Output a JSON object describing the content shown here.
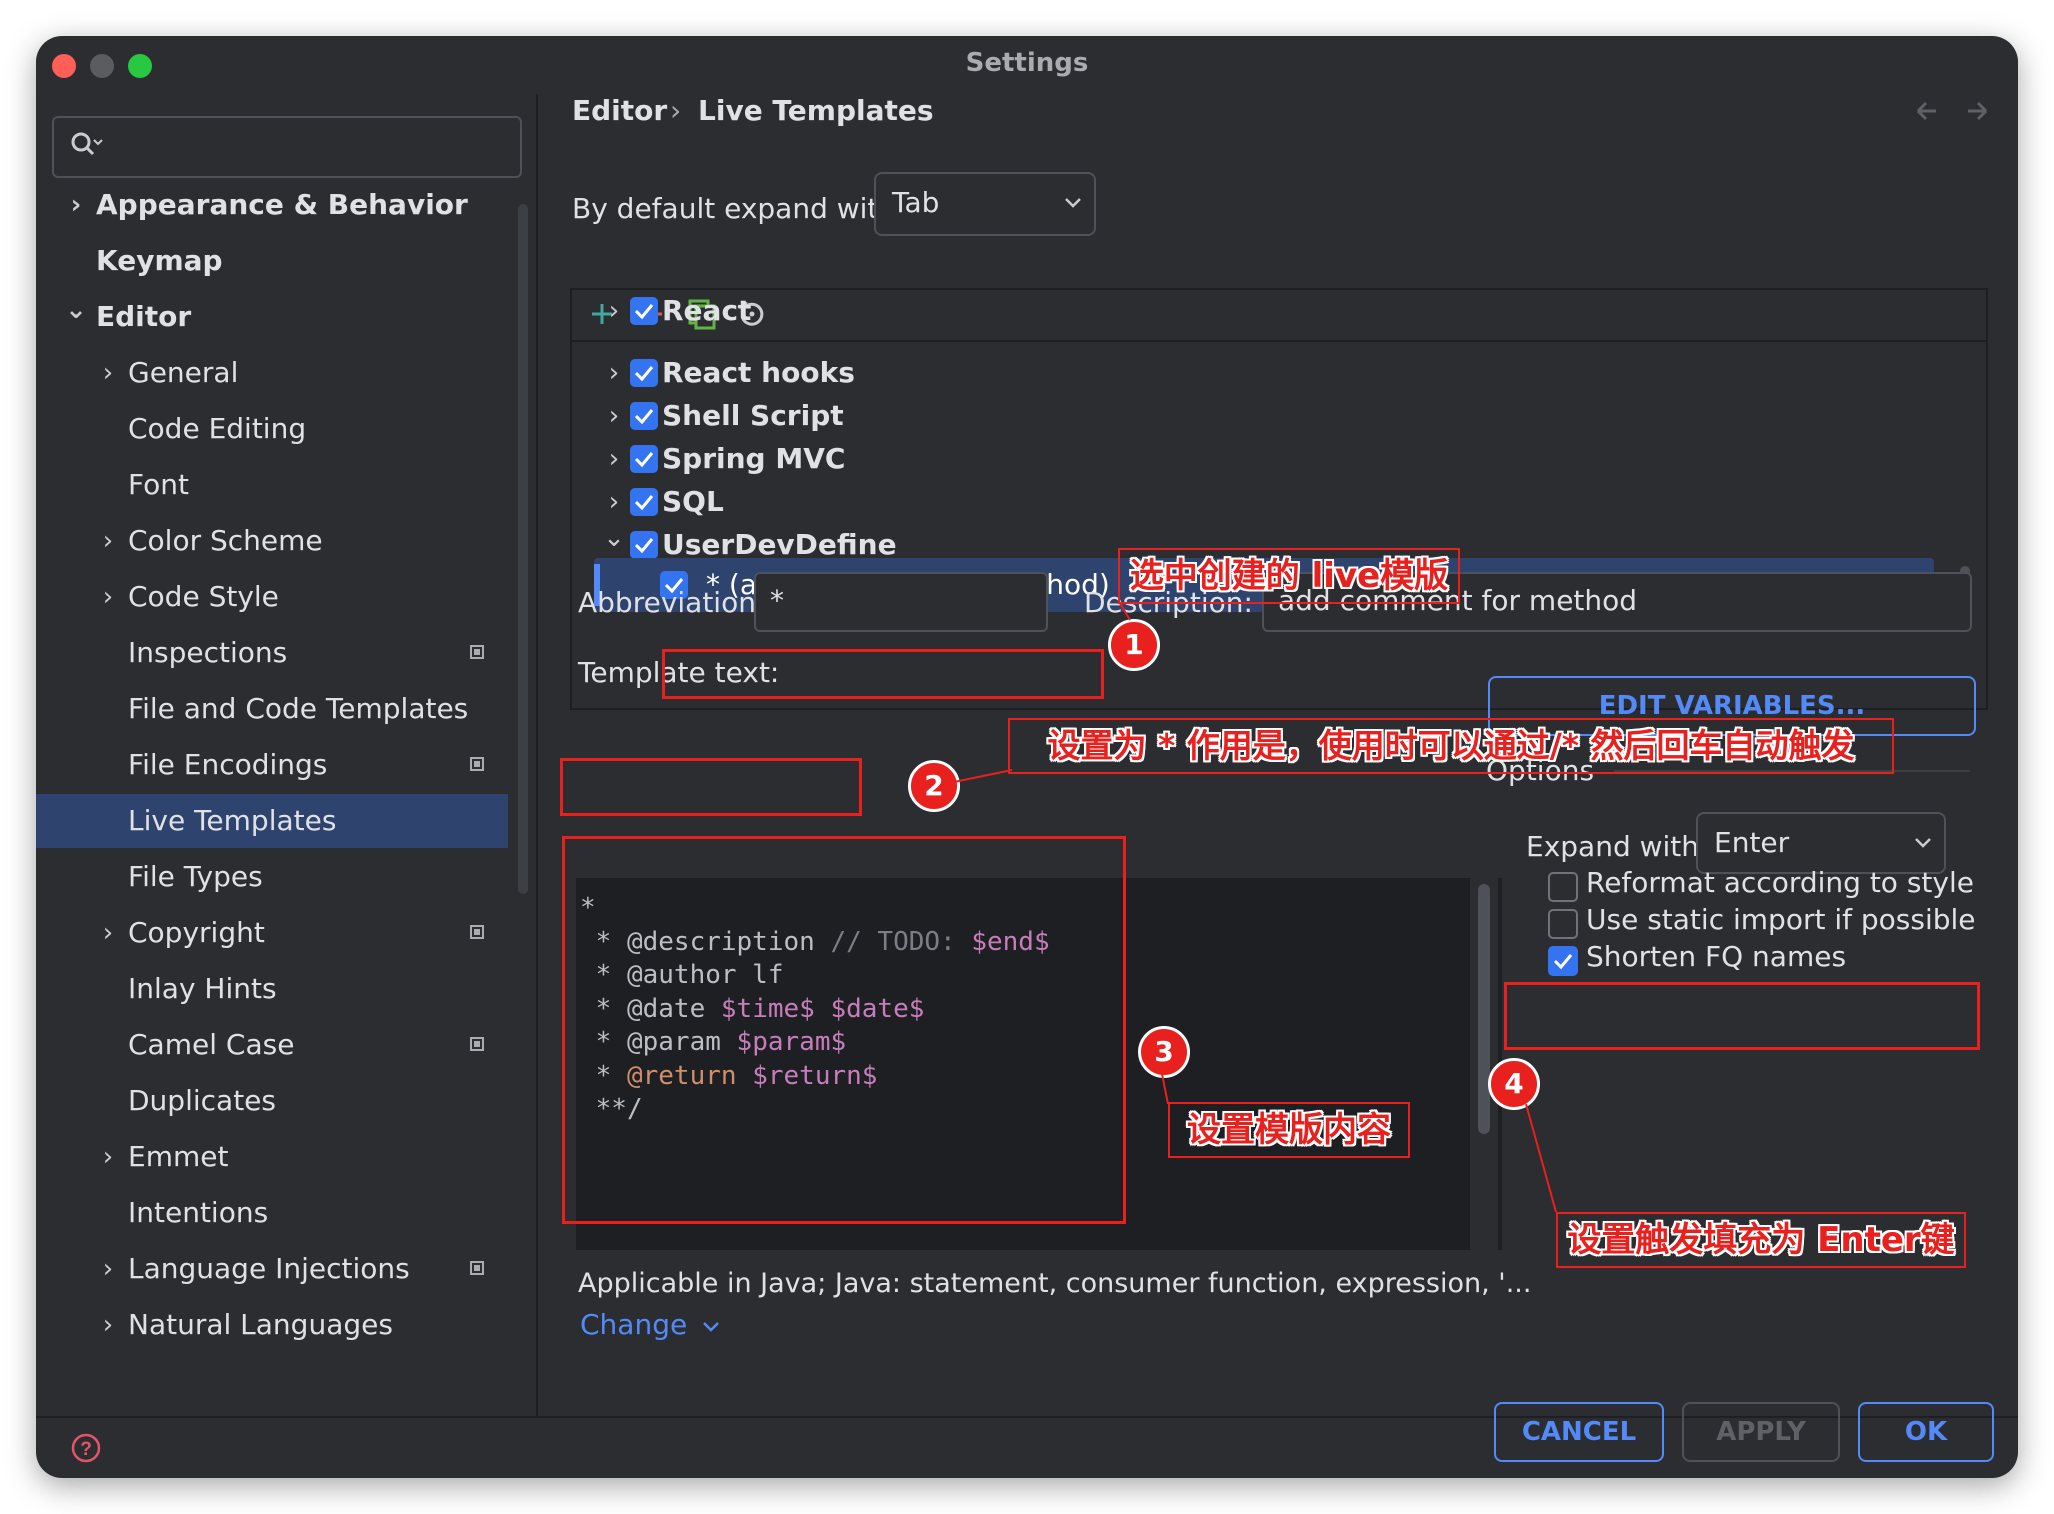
{
  "window": {
    "title": "Settings"
  },
  "sidebar": {
    "search_placeholder": "",
    "items": [
      {
        "label": "Appearance & Behavior",
        "chevron": "right",
        "bold": true
      },
      {
        "label": "Keymap",
        "bold": true
      },
      {
        "label": "Editor",
        "chevron": "down",
        "bold": true
      },
      {
        "label": "General",
        "chevron": "right"
      },
      {
        "label": "Code Editing"
      },
      {
        "label": "Font"
      },
      {
        "label": "Color Scheme",
        "chevron": "right"
      },
      {
        "label": "Code Style",
        "chevron": "right"
      },
      {
        "label": "Inspections",
        "badge_icon": "project-level-icon"
      },
      {
        "label": "File and Code Templates"
      },
      {
        "label": "File Encodings",
        "badge_icon": "project-level-icon"
      },
      {
        "label": "Live Templates",
        "selected": true
      },
      {
        "label": "File Types"
      },
      {
        "label": "Copyright",
        "chevron": "right",
        "badge_icon": "project-level-icon"
      },
      {
        "label": "Inlay Hints"
      },
      {
        "label": "Camel Case",
        "badge_icon": "project-level-icon"
      },
      {
        "label": "Duplicates"
      },
      {
        "label": "Emmet",
        "chevron": "right"
      },
      {
        "label": "Intentions"
      },
      {
        "label": "Language Injections",
        "chevron": "right",
        "badge_icon": "project-level-icon"
      },
      {
        "label": "Natural Languages",
        "chevron": "right"
      }
    ]
  },
  "breadcrumb": {
    "parent": "Editor",
    "separator": "›",
    "current": "Live Templates"
  },
  "expand_default": {
    "label": "By default expand with",
    "value": "Tab"
  },
  "tree_toolbar": [
    "add-icon",
    "remove-icon",
    "copy-icon",
    "restore-icon"
  ],
  "template_groups": [
    {
      "label": "React",
      "checked": true,
      "expanded": false
    },
    {
      "label": "React hooks",
      "checked": true,
      "expanded": false
    },
    {
      "label": "Shell Script",
      "checked": true,
      "expanded": false
    },
    {
      "label": "Spring MVC",
      "checked": true,
      "expanded": false
    },
    {
      "label": "SQL",
      "checked": true,
      "expanded": false
    },
    {
      "label": "UserDevDefine",
      "checked": true,
      "expanded": true
    }
  ],
  "selected_template": {
    "label": "* (add comment for method)",
    "checked": true
  },
  "abbreviation": {
    "label": "Abbreviation:",
    "value": "*"
  },
  "description": {
    "label": "Description:",
    "value": "add comment for method"
  },
  "template_text": {
    "label": "Template text:",
    "lines": [
      "*",
      " * @description // TODO: $end$",
      " * @author lf",
      " * @date $time$ $date$",
      " * @param $param$",
      " * @return $return$",
      " **/"
    ]
  },
  "edit_variables_button": "EDIT VARIABLES...",
  "options": {
    "title": "Options",
    "expand_with_label": "Expand with",
    "expand_with_value": "Enter",
    "checkboxes": [
      {
        "label": "Reformat according to style",
        "checked": false
      },
      {
        "label": "Use static import if possible",
        "checked": false
      },
      {
        "label": "Shorten FQ names",
        "checked": true
      }
    ]
  },
  "applicable": {
    "text": "Applicable in Java; Java: statement, consumer function, expression, '...",
    "change_link": "Change"
  },
  "footer": {
    "help_icon": "help-icon",
    "cancel": "CANCEL",
    "apply": "APPLY",
    "ok": "OK"
  },
  "annotations": {
    "n1": "1",
    "t1": "选中创建的 live模版",
    "n2": "2",
    "t2": "设置为 * 作用是，使用时可以通过/* 然后回车自动触发",
    "n3": "3",
    "t3": "设置模版内容",
    "n4": "4",
    "t4": "设置触发填充为 Enter键"
  },
  "colors": {
    "window_bg": "#2b2d30",
    "selection": "#2e436e",
    "accent": "#3574f0",
    "annotation_red": "#e8201e",
    "link": "#548af7"
  }
}
